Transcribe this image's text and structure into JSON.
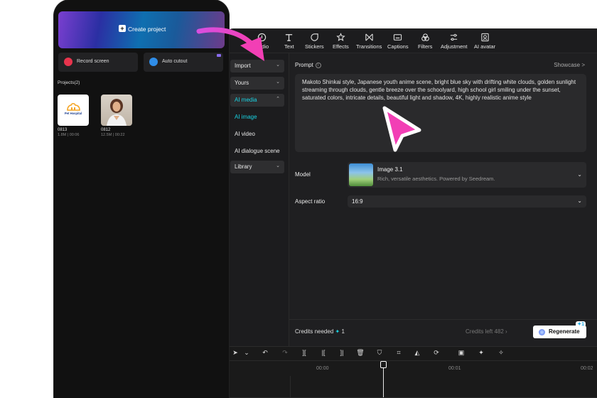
{
  "toolbar": {
    "items": [
      {
        "label": "Audio",
        "icon": "audio-icon"
      },
      {
        "label": "Text",
        "icon": "text-icon"
      },
      {
        "label": "Stickers",
        "icon": "stickers-icon"
      },
      {
        "label": "Effects",
        "icon": "effects-icon"
      },
      {
        "label": "Transitions",
        "icon": "transitions-icon"
      },
      {
        "label": "Captions",
        "icon": "captions-icon"
      },
      {
        "label": "Filters",
        "icon": "filters-icon"
      },
      {
        "label": "Adjustment",
        "icon": "adjustment-icon"
      },
      {
        "label": "AI avatar",
        "icon": "ai-avatar-icon"
      }
    ]
  },
  "sidebar": {
    "import": "Import",
    "yours": "Yours",
    "ai_media": "AI media",
    "ai_image": "AI image",
    "ai_video": "AI video",
    "ai_dialogue": "AI dialogue scene",
    "library": "Library"
  },
  "panel": {
    "prompt_label": "Prompt",
    "showcase": "Showcase >",
    "prompt_text": "Makoto Shinkai style, Japanese youth anime scene, bright blue sky with drifting white clouds, golden sunlight streaming through clouds, gentle breeze over the schoolyard, high school girl smiling under the sunset, saturated colors, intricate details, beautiful light and shadow, 4K, highly realistic anime style",
    "model_label": "Model",
    "model_name": "Image 3.1",
    "model_desc": "Rich, versatile aesthetics. Powered by Seedream.",
    "aspect_label": "Aspect ratio",
    "aspect_value": "16:9",
    "credits_needed_label": "Credits needed",
    "credits_needed_value": "1",
    "credits_left": "Credits left 482",
    "regenerate": "Regenerate",
    "regenerate_badge": "1"
  },
  "timeline": {
    "times": [
      "00:00",
      "00:01",
      "00:02"
    ]
  },
  "phone": {
    "create_project": "Create project",
    "record_screen": "Record screen",
    "auto_cutout": "Auto cutout",
    "projects_title": "Projects(2)",
    "projects": [
      {
        "name": "0813",
        "meta": "1.8M | 00:06",
        "thumb_text": "Pet Hospital"
      },
      {
        "name": "0812",
        "meta": "12.5M | 00:22"
      }
    ]
  },
  "colors": {
    "accent": "#19d3e3",
    "pointer": "#f03cc8"
  }
}
